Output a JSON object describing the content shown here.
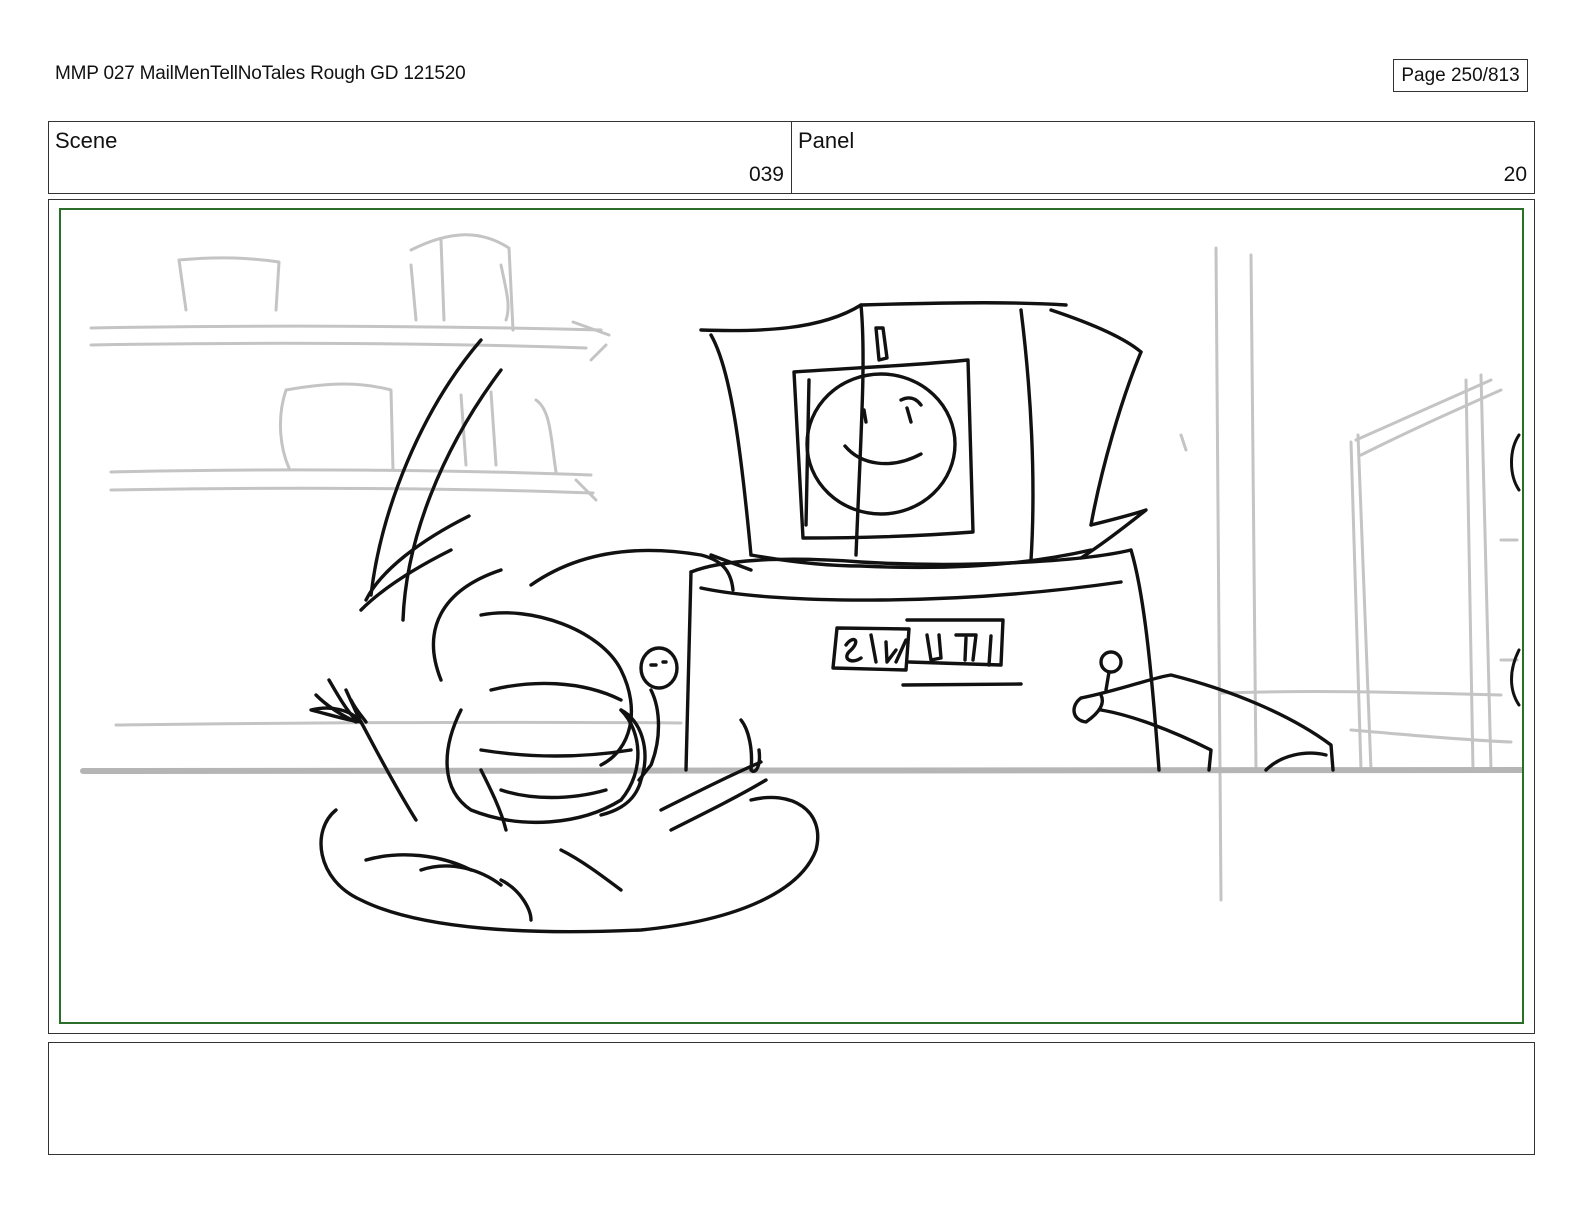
{
  "document": {
    "title": "MMP 027 MailMenTellNoTales Rough GD 121520",
    "page": "Page 250/813"
  },
  "header": {
    "scene_label": "Scene",
    "scene_value": "039",
    "panel_label": "Panel",
    "panel_value": "20"
  },
  "drawing": {
    "sign_left": "SLNJ",
    "sign_right": "TRU",
    "frame_color": "#2a6e2a",
    "ink_color": "#111111",
    "sketch_gray": "#bdbdbd"
  },
  "notes": {
    "text": ""
  }
}
